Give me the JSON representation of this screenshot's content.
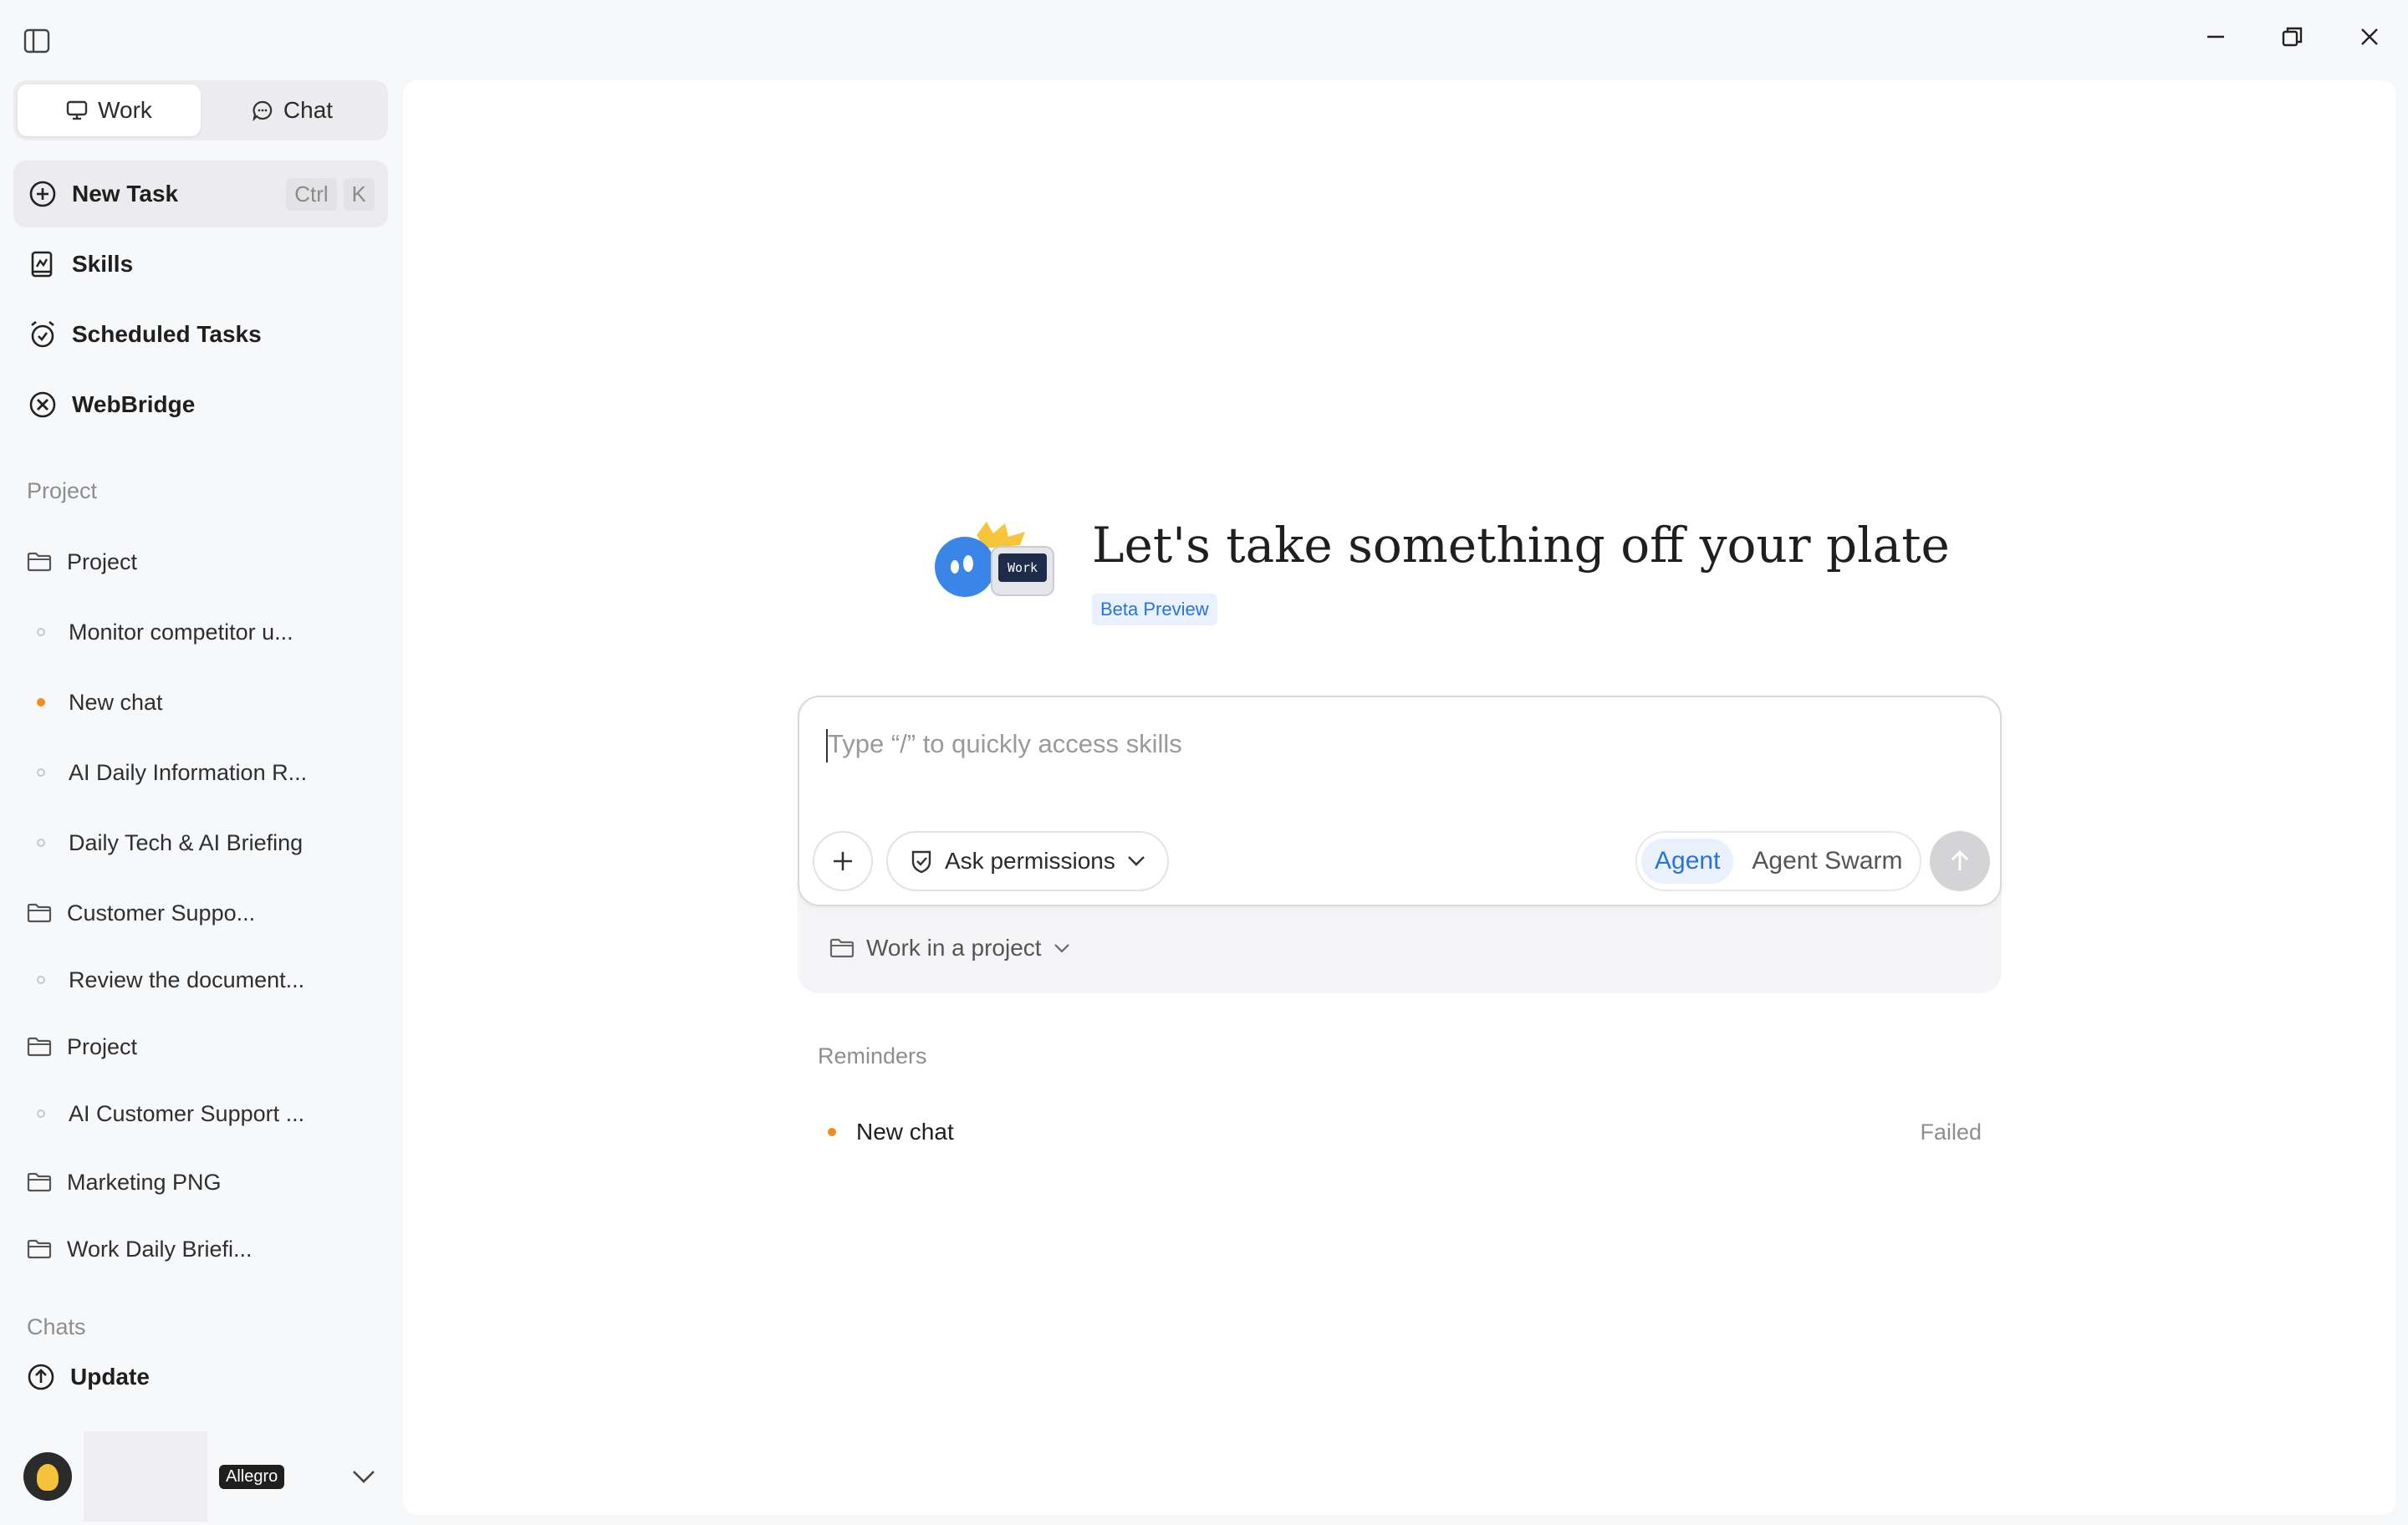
{
  "mode_switch": {
    "work": "Work",
    "chat": "Chat"
  },
  "nav": {
    "new_task": "New Task",
    "shortcut_ctrl": "Ctrl",
    "shortcut_k": "K",
    "skills": "Skills",
    "scheduled_tasks": "Scheduled Tasks",
    "webbridge": "WebBridge"
  },
  "project_section": {
    "label": "Project",
    "items": [
      {
        "type": "folder",
        "label": "Project"
      },
      {
        "type": "task",
        "label": "Monitor competitor u...",
        "status": "idle"
      },
      {
        "type": "task",
        "label": "New chat",
        "status": "active"
      },
      {
        "type": "task",
        "label": "AI Daily Information R...",
        "status": "idle"
      },
      {
        "type": "task",
        "label": "Daily Tech & AI Briefing",
        "status": "idle"
      },
      {
        "type": "folder",
        "label": "Customer Suppo..."
      },
      {
        "type": "task",
        "label": "Review the document...",
        "status": "idle"
      },
      {
        "type": "folder",
        "label": "Project"
      },
      {
        "type": "task",
        "label": "AI Customer Support ...",
        "status": "idle"
      },
      {
        "type": "folder",
        "label": "Marketing PNG"
      },
      {
        "type": "folder",
        "label": "Work Daily Briefi..."
      }
    ]
  },
  "chats_section": {
    "label": "Chats"
  },
  "update": {
    "label": "Update"
  },
  "account": {
    "plan": "Allegro"
  },
  "main": {
    "headline": "Let's take something off your plate",
    "beta_badge": "Beta Preview",
    "mascot_screen_text": "Work",
    "composer": {
      "placeholder": "Type “/” to quickly access skills",
      "permissions": "Ask permissions",
      "agent": "Agent",
      "agent_swarm": "Agent Swarm"
    },
    "project_picker": "Work in a project",
    "reminders": {
      "label": "Reminders",
      "items": [
        {
          "label": "New chat",
          "status": "Failed"
        }
      ]
    }
  },
  "colors": {
    "accent_blue": "#2a74d8",
    "status_orange": "#f28c1b",
    "background": "#f7f8fa"
  }
}
